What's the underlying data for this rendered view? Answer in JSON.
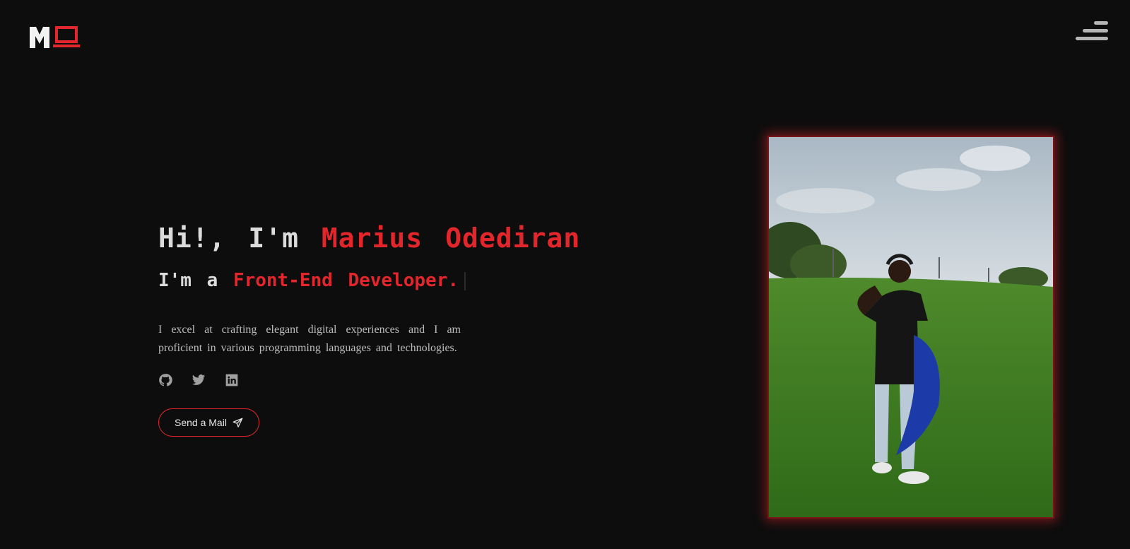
{
  "header": {
    "logo": {
      "text": "MO",
      "icon": "logo-mark"
    },
    "menu": {
      "icon": "hamburger-menu-icon"
    }
  },
  "hero": {
    "greeting_prefix": "Hi!, I'm",
    "name": "Marius Odediran",
    "role_prefix": "I'm a",
    "role": "Front-End Developer.",
    "bio": "I excel at crafting elegant digital experiences and I am proficient in various programming languages and technologies.",
    "socials": [
      {
        "icon": "github-icon"
      },
      {
        "icon": "twitter-icon"
      },
      {
        "icon": "linkedin-icon"
      }
    ],
    "cta": {
      "label": "Send a Mail",
      "icon": "paper-plane-icon"
    }
  },
  "photo": {
    "subject": "profile-photo"
  },
  "colors": {
    "background": "#0d0d0d",
    "accent": "#e3252c",
    "text": "#dcdcdc",
    "muted": "#bdbdbd",
    "icons": "#a0a0a0"
  }
}
